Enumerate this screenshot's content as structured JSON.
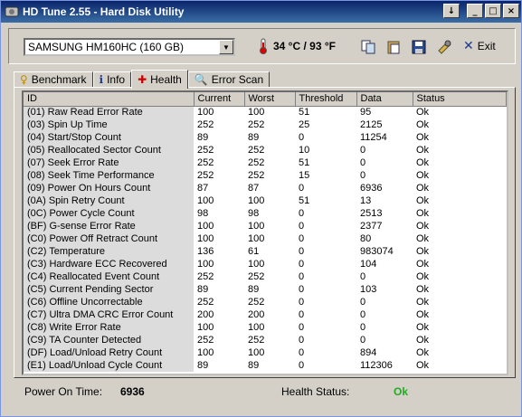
{
  "window": {
    "title": "HD Tune 2.55 - Hard Disk Utility",
    "buttons": [
      "↓",
      "_",
      "□",
      "×"
    ]
  },
  "toolbar": {
    "drive": "SAMSUNG HM160HC (160 GB)",
    "temperature": "34 °C / 93 °F",
    "exit_label": "Exit"
  },
  "tabs": [
    {
      "label": "Benchmark",
      "icon": "benchmark-icon"
    },
    {
      "label": "Info",
      "icon": "info-icon"
    },
    {
      "label": "Health",
      "icon": "health-icon",
      "active": true
    },
    {
      "label": "Error Scan",
      "icon": "error-scan-icon"
    }
  ],
  "table": {
    "columns": [
      "ID",
      "Current",
      "Worst",
      "Threshold",
      "Data",
      "Status"
    ],
    "rows": [
      [
        "(01) Raw Read Error Rate",
        "100",
        "100",
        "51",
        "95",
        "Ok"
      ],
      [
        "(03) Spin Up Time",
        "252",
        "252",
        "25",
        "2125",
        "Ok"
      ],
      [
        "(04) Start/Stop Count",
        "89",
        "89",
        "0",
        "11254",
        "Ok"
      ],
      [
        "(05) Reallocated Sector Count",
        "252",
        "252",
        "10",
        "0",
        "Ok"
      ],
      [
        "(07) Seek Error Rate",
        "252",
        "252",
        "51",
        "0",
        "Ok"
      ],
      [
        "(08) Seek Time Performance",
        "252",
        "252",
        "15",
        "0",
        "Ok"
      ],
      [
        "(09) Power On Hours Count",
        "87",
        "87",
        "0",
        "6936",
        "Ok"
      ],
      [
        "(0A) Spin Retry Count",
        "100",
        "100",
        "51",
        "13",
        "Ok"
      ],
      [
        "(0C) Power Cycle Count",
        "98",
        "98",
        "0",
        "2513",
        "Ok"
      ],
      [
        "(BF) G-sense Error Rate",
        "100",
        "100",
        "0",
        "2377",
        "Ok"
      ],
      [
        "(C0) Power Off Retract Count",
        "100",
        "100",
        "0",
        "80",
        "Ok"
      ],
      [
        "(C2) Temperature",
        "136",
        "61",
        "0",
        "983074",
        "Ok"
      ],
      [
        "(C3) Hardware ECC Recovered",
        "100",
        "100",
        "0",
        "104",
        "Ok"
      ],
      [
        "(C4) Reallocated Event Count",
        "252",
        "252",
        "0",
        "0",
        "Ok"
      ],
      [
        "(C5) Current Pending Sector",
        "89",
        "89",
        "0",
        "103",
        "Ok"
      ],
      [
        "(C6) Offline Uncorrectable",
        "252",
        "252",
        "0",
        "0",
        "Ok"
      ],
      [
        "(C7) Ultra DMA CRC Error Count",
        "200",
        "200",
        "0",
        "0",
        "Ok"
      ],
      [
        "(C8) Write Error Rate",
        "100",
        "100",
        "0",
        "0",
        "Ok"
      ],
      [
        "(C9) TA Counter Detected",
        "252",
        "252",
        "0",
        "0",
        "Ok"
      ],
      [
        "(DF) Load/Unload Retry Count",
        "100",
        "100",
        "0",
        "894",
        "Ok"
      ],
      [
        "(E1) Load/Unload Cycle Count",
        "89",
        "89",
        "0",
        "112306",
        "Ok"
      ]
    ]
  },
  "status": {
    "power_on_label": "Power On Time:",
    "power_on_value": "6936",
    "health_label": "Health Status:",
    "health_value": "Ok"
  },
  "colors": {
    "title_bar": "#0a246a",
    "health_ok": "#22aa22"
  }
}
